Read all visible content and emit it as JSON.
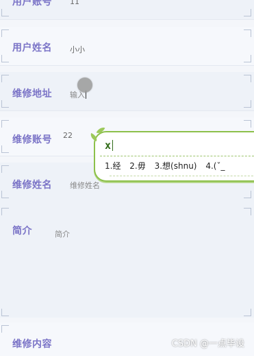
{
  "form": {
    "user_account": {
      "label": "用户账号",
      "value": "11"
    },
    "user_name": {
      "label": "用户姓名",
      "value": "小小"
    },
    "repair_address": {
      "label": "维修地址",
      "value": "输入"
    },
    "repair_account": {
      "label": "维修账号",
      "value": "22"
    },
    "repair_name": {
      "label": "维修姓名",
      "placeholder": "维修姓名"
    },
    "intro": {
      "label": "简介",
      "placeholder": "简介"
    },
    "repair_content": {
      "label": "维修内容"
    }
  },
  "ime": {
    "input": "x",
    "candidates": [
      {
        "index": "1.",
        "text": "经"
      },
      {
        "index": "2.",
        "text": "毋"
      },
      {
        "index": "3.",
        "text": "想(shnu)"
      },
      {
        "index": "4.",
        "text": "(ˇ_"
      }
    ]
  },
  "watermark": "CSDN @一点毕设"
}
